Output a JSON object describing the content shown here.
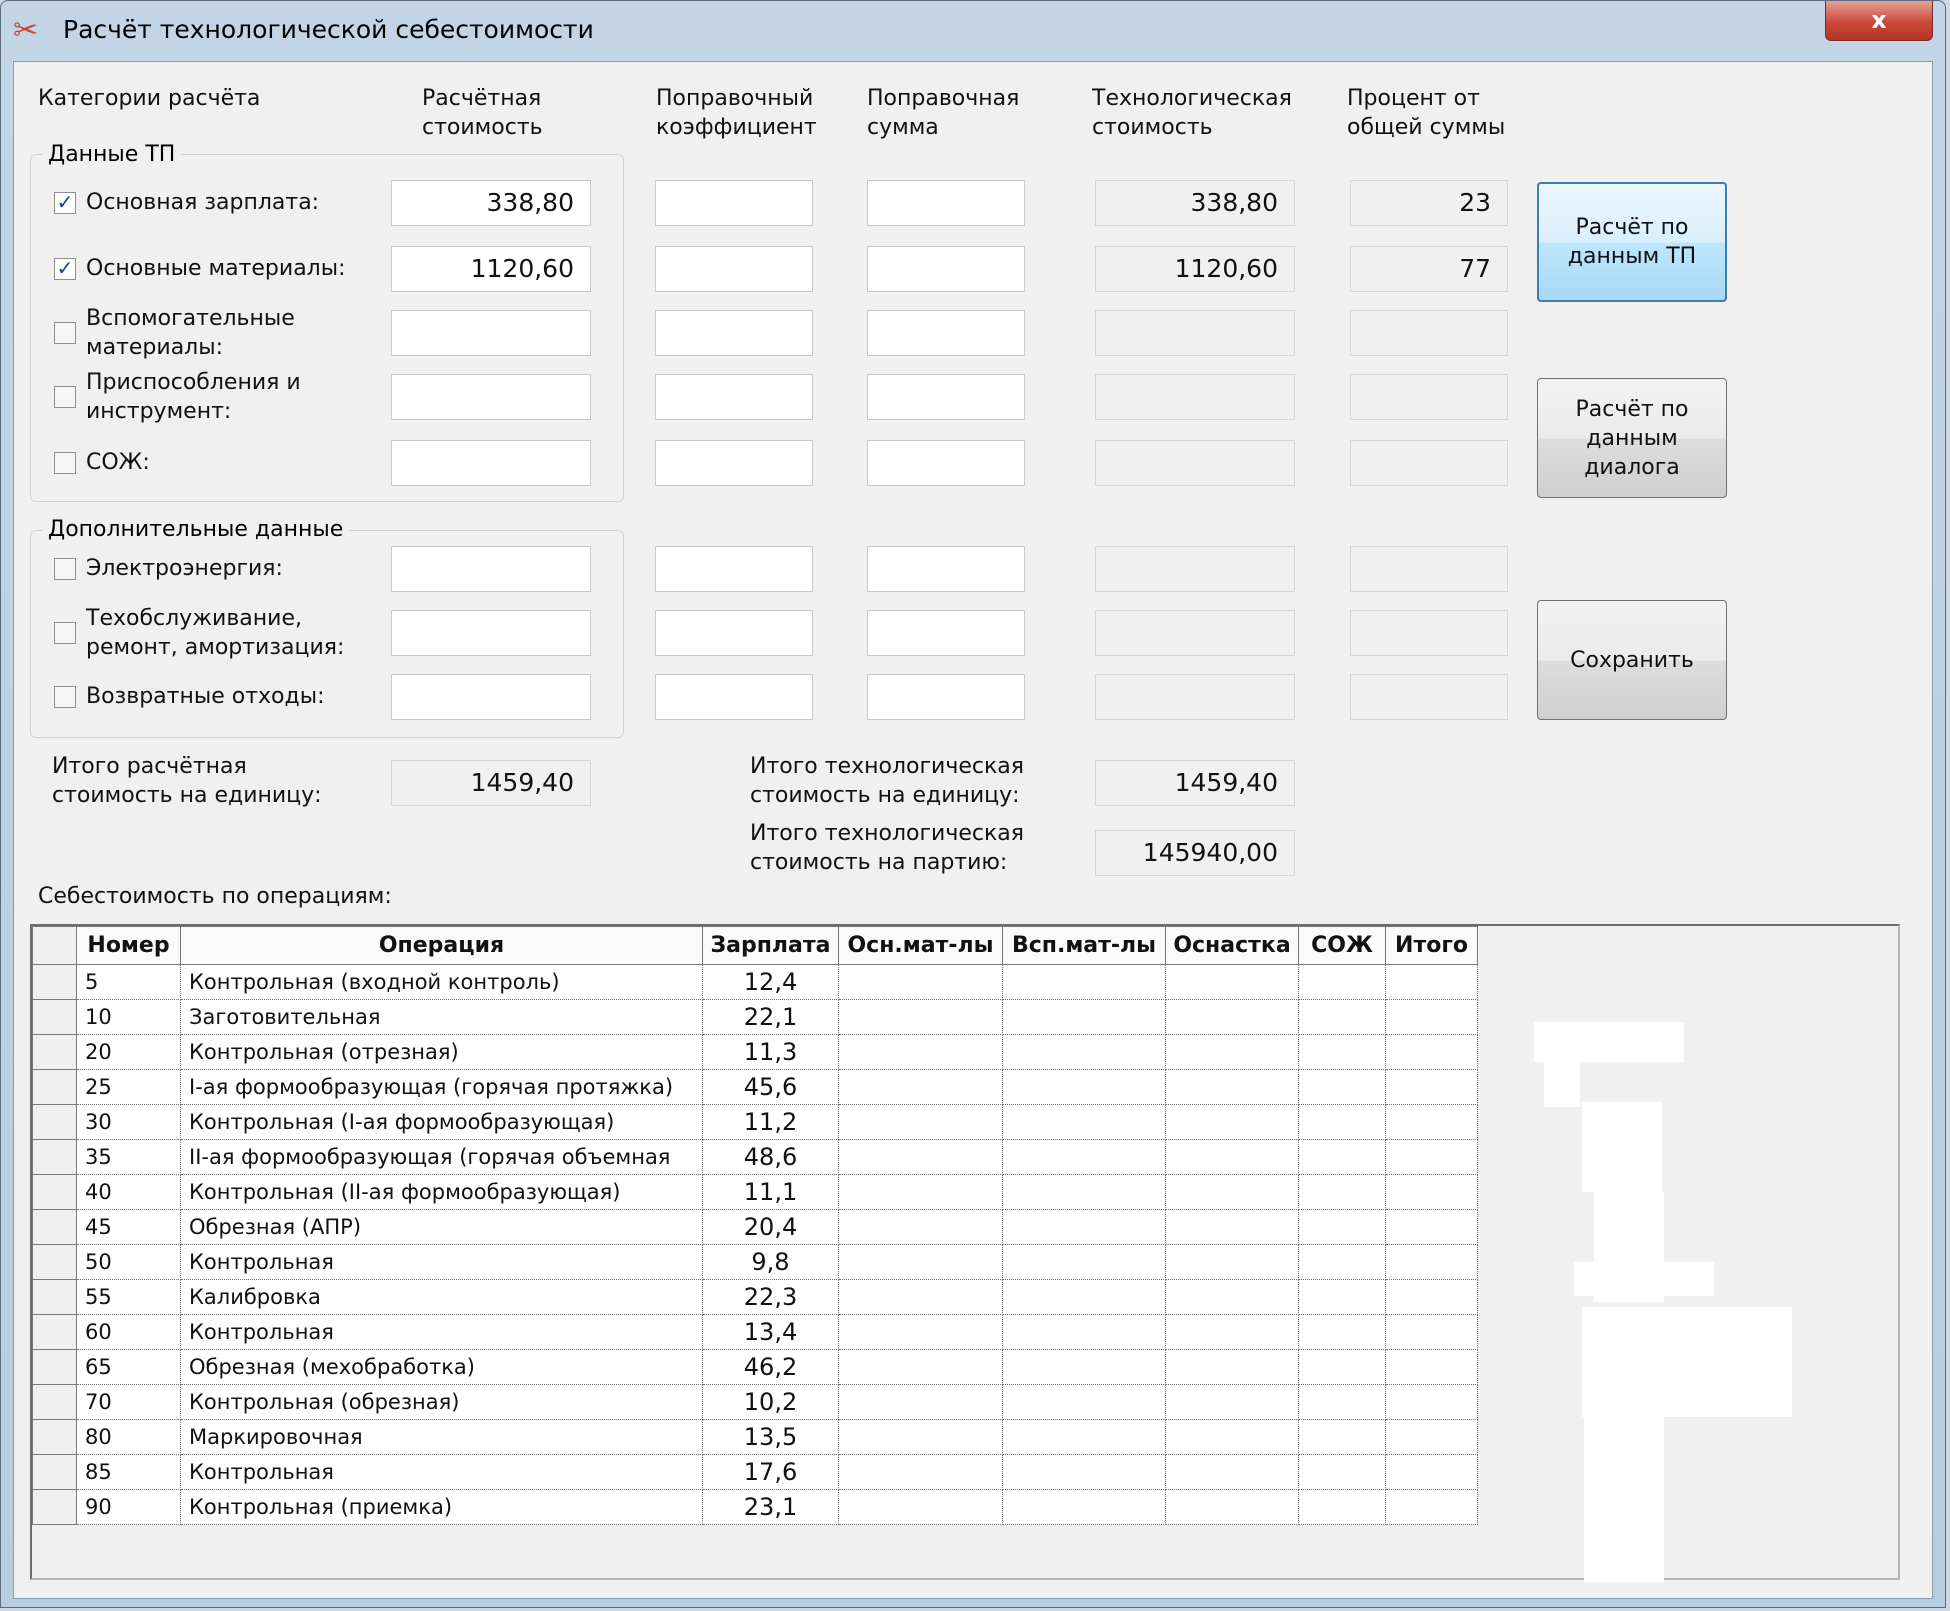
{
  "window": {
    "title": "Расчёт технологической себестоимости",
    "close_label": "x",
    "app_icon": "scissors-icon"
  },
  "headers": {
    "categories": "Категории расчёта",
    "calc_cost": "Расчётная\nстоимость",
    "corr_coef": "Поправочный\nкоэффициент",
    "corr_sum": "Поправочная\nсумма",
    "tech_cost": "Технологическая\nстоимость",
    "percent": "Процент от\nобщей суммы"
  },
  "group_tp": {
    "title": "Данные ТП",
    "rows": [
      {
        "label": "Основная зарплата:",
        "checked": true,
        "calc": "338,80",
        "coef": "",
        "sum": "",
        "tech": "338,80",
        "percent": "23"
      },
      {
        "label": "Основные материалы:",
        "checked": true,
        "calc": "1120,60",
        "coef": "",
        "sum": "",
        "tech": "1120,60",
        "percent": "77"
      },
      {
        "label": "Вспомогательные\nматериалы:",
        "checked": false,
        "calc": "",
        "coef": "",
        "sum": "",
        "tech": "",
        "percent": ""
      },
      {
        "label": "Приспособления и\nинструмент:",
        "checked": false,
        "calc": "",
        "coef": "",
        "sum": "",
        "tech": "",
        "percent": ""
      },
      {
        "label": "СОЖ:",
        "checked": false,
        "calc": "",
        "coef": "",
        "sum": "",
        "tech": "",
        "percent": ""
      }
    ]
  },
  "group_extra": {
    "title": "Дополнительные данные",
    "rows": [
      {
        "label": "Электроэнергия:",
        "checked": false,
        "calc": "",
        "coef": "",
        "sum": "",
        "tech": "",
        "percent": ""
      },
      {
        "label": "Техобслуживание,\nремонт, амортизация:",
        "checked": false,
        "calc": "",
        "coef": "",
        "sum": "",
        "tech": "",
        "percent": ""
      },
      {
        "label": "Возвратные отходы:",
        "checked": false,
        "calc": "",
        "coef": "",
        "sum": "",
        "tech": "",
        "percent": ""
      }
    ]
  },
  "buttons": {
    "calc_tp": "Расчёт по\nданным ТП",
    "calc_dialog": "Расчёт по\nданным\nдиалога",
    "save": "Сохранить"
  },
  "totals": {
    "calc_unit_label": "Итого расчётная\nстоимость на единицу:",
    "calc_unit_value": "1459,40",
    "tech_unit_label": "Итого технологическая\nстоимость на единицу:",
    "tech_unit_value": "1459,40",
    "tech_batch_label": "Итого технологическая\nстоимость на партию:",
    "tech_batch_value": "145940,00"
  },
  "operations": {
    "label": "Себестоимость по операциям:",
    "columns": [
      "Номер",
      "Операция",
      "Зарплата",
      "Осн.мат-лы",
      "Всп.мат-лы",
      "Оснастка",
      "СОЖ",
      "Итого"
    ],
    "rows": [
      {
        "num": "5",
        "op": "Контрольная (входной контроль)",
        "pay": "12,4"
      },
      {
        "num": "10",
        "op": "Заготовительная",
        "pay": "22,1"
      },
      {
        "num": "20",
        "op": "Контрольная (отрезная)",
        "pay": "11,3"
      },
      {
        "num": "25",
        "op": "I-ая формообразующая (горячая протяжка)",
        "pay": "45,6"
      },
      {
        "num": "30",
        "op": "Контрольная (I-ая формообразующая)",
        "pay": "11,2"
      },
      {
        "num": "35",
        "op": "II-ая формообразующая (горячая объемная",
        "pay": "48,6"
      },
      {
        "num": "40",
        "op": "Контрольная (II-ая формообразующая)",
        "pay": "11,1"
      },
      {
        "num": "45",
        "op": "Обрезная (АПР)",
        "pay": "20,4"
      },
      {
        "num": "50",
        "op": "Контрольная",
        "pay": "9,8"
      },
      {
        "num": "55",
        "op": "Калибровка",
        "pay": "22,3"
      },
      {
        "num": "60",
        "op": "Контрольная",
        "pay": "13,4"
      },
      {
        "num": "65",
        "op": "Обрезная (мехобработка)",
        "pay": "46,2"
      },
      {
        "num": "70",
        "op": "Контрольная (обрезная)",
        "pay": "10,2"
      },
      {
        "num": "80",
        "op": "Маркировочная",
        "pay": "13,5"
      },
      {
        "num": "85",
        "op": "Контрольная",
        "pay": "17,6"
      },
      {
        "num": "90",
        "op": "Контрольная (приемка)",
        "pay": "23,1"
      }
    ]
  }
}
